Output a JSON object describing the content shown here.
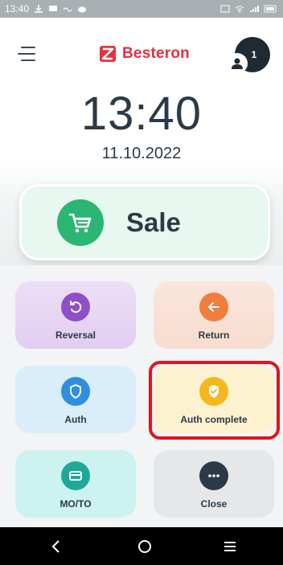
{
  "status_bar": {
    "time": "13:40"
  },
  "header": {
    "brand_name": "Besteron",
    "notification_count": "1"
  },
  "clock": {
    "time": "13:40",
    "date": "11.10.2022"
  },
  "sale": {
    "label": "Sale"
  },
  "tiles": [
    {
      "label": "Reversal",
      "icon": "rotate-ccw-icon"
    },
    {
      "label": "Return",
      "icon": "arrow-left-icon"
    },
    {
      "label": "Auth",
      "icon": "shield-icon"
    },
    {
      "label": "Auth complete",
      "icon": "shield-check-icon"
    },
    {
      "label": "MO/TO",
      "icon": "credit-card-icon"
    },
    {
      "label": "Close",
      "icon": "more-dots-icon"
    }
  ],
  "colors": {
    "brand": "#e5303e",
    "sale_green": "#2bb673",
    "reversal": "#8e4fc9",
    "return": "#f07d3b",
    "auth": "#2f8ee0",
    "auth_complete": "#f5b81c",
    "moto": "#1ea89a",
    "close": "#2b3a46",
    "highlight": "#e3131c"
  }
}
